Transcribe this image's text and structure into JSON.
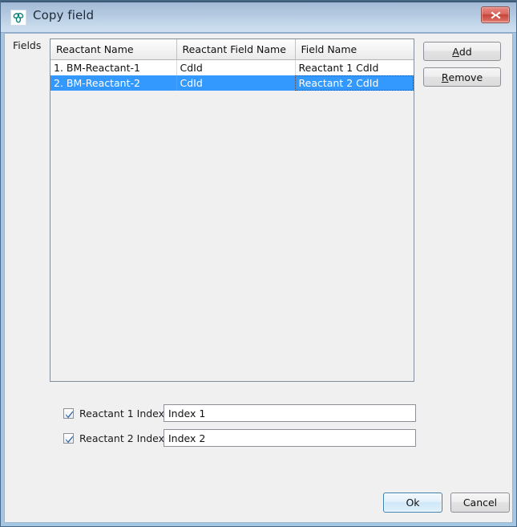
{
  "window": {
    "title": "Copy field",
    "icon": "molecule-icon",
    "close_label": "x",
    "accent_selection": "#3399ff",
    "titlebar_gradient_top": "#9fb7d4",
    "titlebar_gradient_bottom": "#cfdfef",
    "background": "#f0f0f0"
  },
  "form": {
    "fields_label": "Fields"
  },
  "table": {
    "columns": [
      "Reactant Name",
      "Reactant Field Name",
      "Field Name"
    ],
    "rows": [
      {
        "cells": [
          "1. BM-Reactant-1",
          "CdId",
          "Reactant 1 CdId"
        ],
        "selected": false
      },
      {
        "cells": [
          "2. BM-Reactant-2",
          "CdId",
          "Reactant 2 CdId"
        ],
        "selected": true
      }
    ]
  },
  "side_buttons": {
    "add": {
      "label": "Add",
      "mnemonic": "A"
    },
    "remove": {
      "label": "Remove",
      "mnemonic": "R"
    }
  },
  "index_options": [
    {
      "checkbox_label": "Reactant 1 Index",
      "checked": true,
      "value": "Index 1",
      "placeholder": ""
    },
    {
      "checkbox_label": "Reactant 2 Index",
      "checked": true,
      "value": "Index 2",
      "placeholder": ""
    }
  ],
  "footer": {
    "ok_label": "Ok",
    "cancel_label": "Cancel"
  }
}
